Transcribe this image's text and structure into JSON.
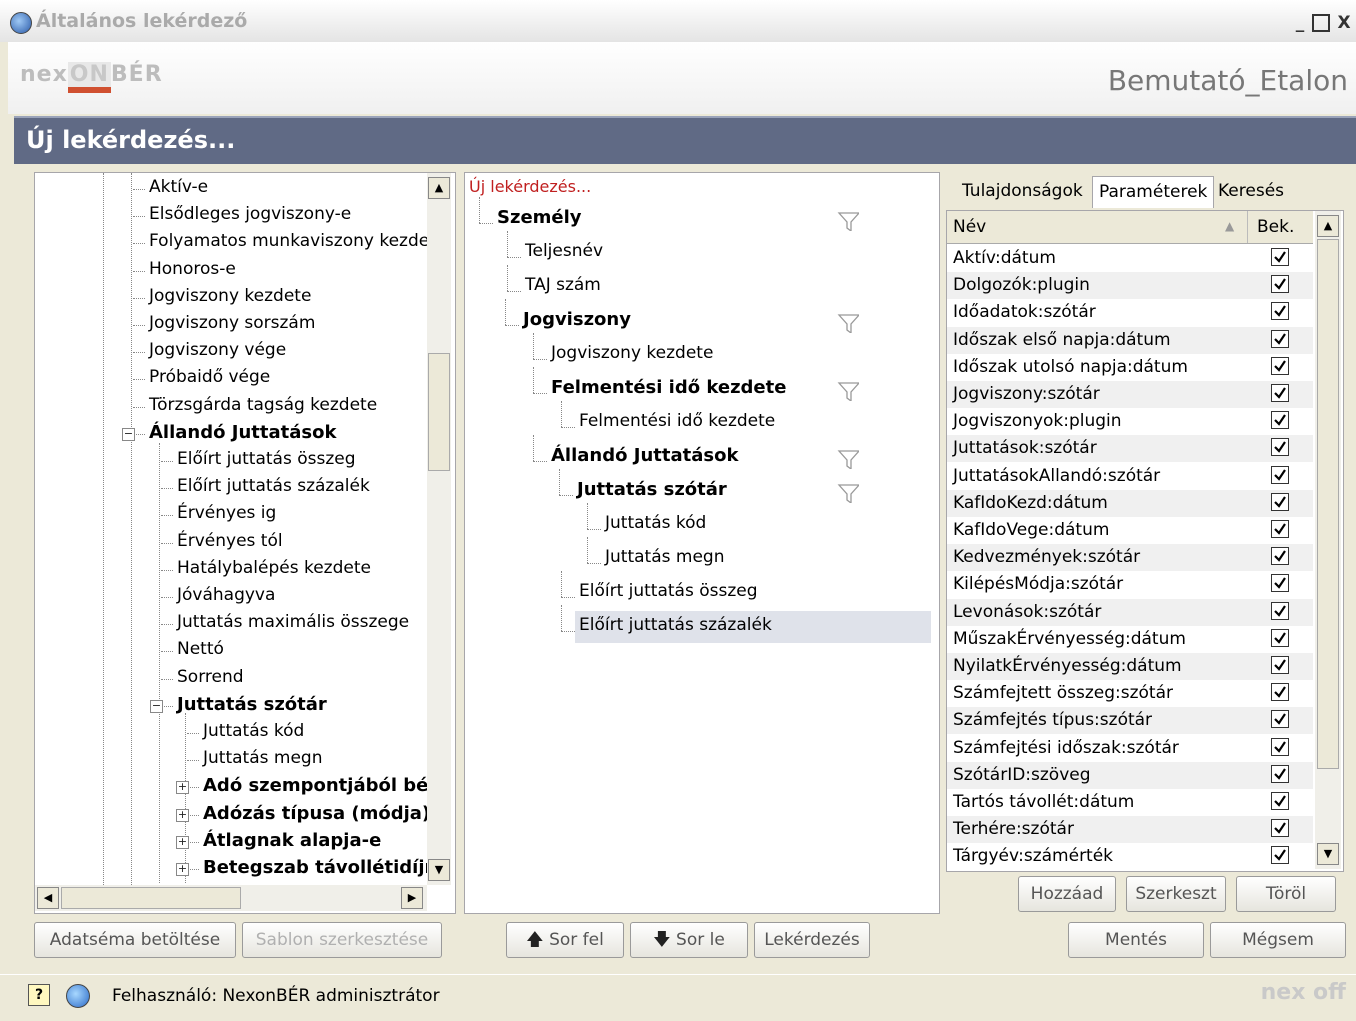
{
  "window": {
    "title": "Általános lekérdező",
    "min_label": "_",
    "max_label": "□",
    "close_label": "X"
  },
  "header": {
    "logo_left": "nex",
    "logo_on": "ON",
    "logo_right": "BÉR",
    "company": "Bemutató_Etalon"
  },
  "band": {
    "title": "Új lekérdezés..."
  },
  "schema_tree": {
    "items": [
      {
        "label": "Aktív-e",
        "bold": false
      },
      {
        "label": "Elsődleges jogviszony-e",
        "bold": false
      },
      {
        "label": "Folyamatos munkaviszony kezdete",
        "bold": false
      },
      {
        "label": "Honoros-e",
        "bold": false
      },
      {
        "label": "Jogviszony kezdete",
        "bold": false
      },
      {
        "label": "Jogviszony sorszám",
        "bold": false
      },
      {
        "label": "Jogviszony vége",
        "bold": false
      },
      {
        "label": "Próbaidő vége",
        "bold": false
      },
      {
        "label": "Törzsgárda tagság kezdete",
        "bold": false
      },
      {
        "label": "Állandó Juttatások",
        "bold": true
      },
      {
        "label": "Előírt juttatás összeg",
        "bold": false
      },
      {
        "label": "Előírt juttatás százalék",
        "bold": false
      },
      {
        "label": "Érvényes ig",
        "bold": false
      },
      {
        "label": "Érvényes tól",
        "bold": false
      },
      {
        "label": "Hatálybalépés kezdete",
        "bold": false
      },
      {
        "label": "Jóváhagyva",
        "bold": false
      },
      {
        "label": "Juttatás maximális összege",
        "bold": false
      },
      {
        "label": "Nettó",
        "bold": false
      },
      {
        "label": "Sorrend",
        "bold": false
      },
      {
        "label": "Juttatás szótár",
        "bold": true
      },
      {
        "label": "Juttatás kód",
        "bold": false
      },
      {
        "label": "Juttatás megn",
        "bold": false
      },
      {
        "label": "Adó szempontjából bérj",
        "bold": true
      },
      {
        "label": "Adózás típusa (módja)",
        "bold": true
      },
      {
        "label": "Átlagnak alapja-e",
        "bold": true
      },
      {
        "label": "Betegszab távollétidíjr",
        "bold": true
      }
    ]
  },
  "query_tree": {
    "root_label": "Új lekérdezés...",
    "items": [
      {
        "label": "Személy",
        "bold": true,
        "filter": true
      },
      {
        "label": "Teljesnév",
        "bold": false,
        "filter": false
      },
      {
        "label": "TAJ szám",
        "bold": false,
        "filter": false
      },
      {
        "label": "Jogviszony",
        "bold": true,
        "filter": true
      },
      {
        "label": "Jogviszony kezdete",
        "bold": false,
        "filter": false
      },
      {
        "label": "Felmentési idő kezdete",
        "bold": true,
        "filter": true
      },
      {
        "label": "Felmentési idő kezdete",
        "bold": false,
        "filter": false
      },
      {
        "label": "Állandó Juttatások",
        "bold": true,
        "filter": true
      },
      {
        "label": "Juttatás szótár",
        "bold": true,
        "filter": true
      },
      {
        "label": "Juttatás kód",
        "bold": false,
        "filter": false
      },
      {
        "label": "Juttatás megn",
        "bold": false,
        "filter": false
      },
      {
        "label": "Előírt juttatás összeg",
        "bold": false,
        "filter": false
      },
      {
        "label": "Előírt juttatás százalék",
        "bold": false,
        "filter": false,
        "selected": true
      }
    ]
  },
  "tabs": {
    "properties": "Tulajdonságok",
    "parameters": "Paraméterek",
    "search": "Keresés"
  },
  "grid": {
    "col_name": "Név",
    "col_bek": "Bek.",
    "rows": [
      "Aktív:dátum",
      "Dolgozók:plugin",
      "Időadatok:szótár",
      "Időszak első napja:dátum",
      "Időszak utolsó napja:dátum",
      "Jogviszony:szótár",
      "Jogviszonyok:plugin",
      "Juttatások:szótár",
      "JuttatásokAllandó:szótár",
      "KafIdoKezd:dátum",
      "KafIdoVege:dátum",
      "Kedvezmények:szótár",
      "KilépésMódja:szótár",
      "Levonások:szótár",
      "MűszakÉrvényesség:dátum",
      "NyilatkÉrvényesség:dátum",
      "Számfejtett összeg:szótár",
      "Számfejtés típus:szótár",
      "Számfejtési időszak:szótár",
      "SzótárID:szöveg",
      "Tartós távollét:dátum",
      "Terhére:szótár",
      "Tárgyév:számérték"
    ]
  },
  "buttons": {
    "add": "Hozzáad",
    "edit": "Szerkeszt",
    "delete": "Töröl",
    "load_schema": "Adatséma betöltése",
    "edit_template": "Sablon szerkesztése",
    "row_up": "Sor fel",
    "row_down": "Sor le",
    "query": "Lekérdezés",
    "save": "Mentés",
    "cancel": "Mégsem"
  },
  "status": {
    "user": "Felhasználó: NexonBÉR adminisztrátor",
    "logo_small": "nex off"
  }
}
